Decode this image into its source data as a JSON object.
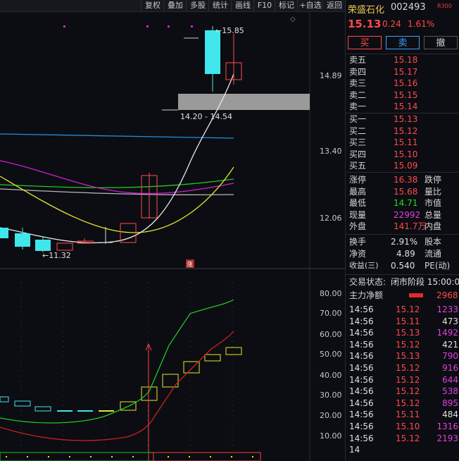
{
  "toolbar": {
    "buttons": [
      "复权",
      "叠加",
      "多股",
      "统计",
      "画线",
      "F10",
      "标记",
      "+自选",
      "返回"
    ]
  },
  "chart": {
    "price_axis": [
      "14.89",
      "13.40",
      "12.06"
    ],
    "high_label": "15.85",
    "low_label": "←11.32",
    "range_label": "14.20 - 14.54",
    "limit_marker": "涨",
    "indicator_axis": [
      "80.00",
      "70.00",
      "60.00",
      "50.00",
      "40.00",
      "30.00",
      "20.00",
      "10.00"
    ]
  },
  "colors": {
    "up": "#ff4a4a",
    "down": "#3fe6ec",
    "gold": "#e8c454",
    "ma_white": "#d8d8d8",
    "ma_yellow": "#e6e62a",
    "ma_magenta": "#d21ed2",
    "ma_green": "#22c822",
    "ma_blue": "#2a8ad8"
  },
  "quote": {
    "name": "荣盛石化",
    "code": "002493",
    "badge": "R300",
    "price": "15.13",
    "change": "0.24",
    "change_pct": "1.61%",
    "buttons": {
      "buy": "买",
      "sell": "卖",
      "cancel": "撤"
    },
    "asks": [
      {
        "label": "卖五",
        "price": "15.18"
      },
      {
        "label": "卖四",
        "price": "15.17"
      },
      {
        "label": "卖三",
        "price": "15.16"
      },
      {
        "label": "卖二",
        "price": "15.15"
      },
      {
        "label": "卖一",
        "price": "15.14"
      }
    ],
    "bids": [
      {
        "label": "买一",
        "price": "15.13"
      },
      {
        "label": "买二",
        "price": "15.12"
      },
      {
        "label": "买三",
        "price": "15.11"
      },
      {
        "label": "买四",
        "price": "15.10"
      },
      {
        "label": "买五",
        "price": "15.09"
      }
    ],
    "stats": [
      {
        "l1": "涨停",
        "v1": "16.38",
        "l2": "跌停"
      },
      {
        "l1": "最高",
        "v1": "15.68",
        "l2": "量比"
      },
      {
        "l1": "最低",
        "v1": "14.71",
        "l2": "市值"
      },
      {
        "l1": "现量",
        "v1": "22992",
        "l2": "总量"
      },
      {
        "l1": "外盘",
        "v1": "141.7万",
        "l2": "内盘"
      }
    ],
    "fund": [
      {
        "l1": "换手",
        "v1": "2.91%",
        "l2": "股本"
      },
      {
        "l1": "净资",
        "v1": "4.89",
        "l2": "流通"
      },
      {
        "l1": "收益(三)",
        "v1": "0.540",
        "l2": "PE(动)"
      }
    ],
    "status_label": "交易状态:",
    "status_value": "闭市阶段 15:00:00",
    "main_flow_label": "主力净额",
    "main_flow_value": "2968",
    "ticks": [
      {
        "t": "14:56",
        "p": "15.12",
        "v": "1233"
      },
      {
        "t": "14:56",
        "p": "15.11",
        "v": "473"
      },
      {
        "t": "14:56",
        "p": "15.13",
        "v": "1492"
      },
      {
        "t": "14:56",
        "p": "15.12",
        "v": "421"
      },
      {
        "t": "14:56",
        "p": "15.13",
        "v": "790"
      },
      {
        "t": "14:56",
        "p": "15.12",
        "v": "916"
      },
      {
        "t": "14:56",
        "p": "15.12",
        "v": "644"
      },
      {
        "t": "14:56",
        "p": "15.12",
        "v": "538"
      },
      {
        "t": "14:56",
        "p": "15.12",
        "v": "895"
      },
      {
        "t": "14:56",
        "p": "15.11",
        "v": "484"
      },
      {
        "t": "14:56",
        "p": "15.10",
        "v": "1316"
      },
      {
        "t": "14:56",
        "p": "15.12",
        "v": "2193"
      },
      {
        "t": "14",
        "p": "",
        "v": ""
      }
    ]
  }
}
